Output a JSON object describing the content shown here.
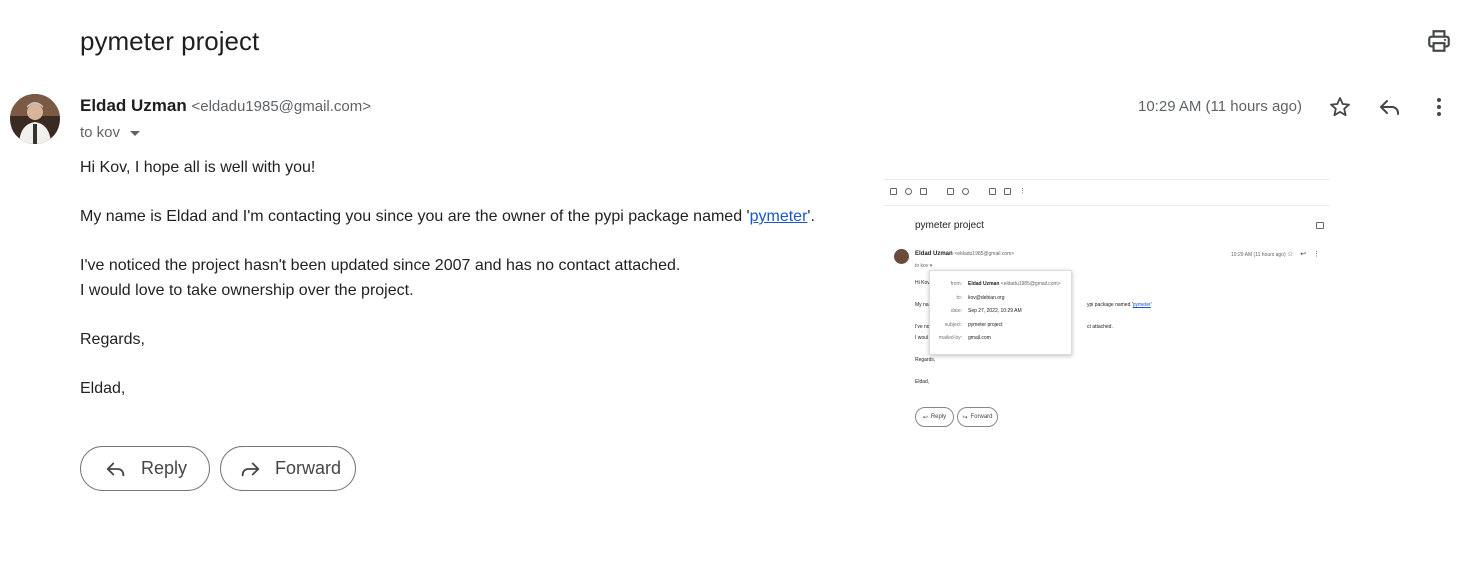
{
  "email": {
    "subject": "pymeter project",
    "sender_name": "Eldad Uzman",
    "sender_email": "<eldadu1985@gmail.com>",
    "to": "to kov",
    "timestamp": "10:29 AM (11 hours ago)",
    "body": {
      "greeting": "Hi Kov, I hope all is well with you!",
      "p2_before": "My name is Eldad and I'm contacting you since you are the owner of the pypi package named '",
      "p2_link": "pymeter",
      "p2_after": "'.",
      "p3_line1": "I've noticed the project hasn't been updated since 2007 and has no contact attached.",
      "p3_line2": "I would love to take ownership over the project.",
      "closing": "Regards,",
      "signature": "Eldad,"
    }
  },
  "actions": {
    "reply": "Reply",
    "forward": "Forward"
  },
  "icons": {
    "print": "print-icon",
    "star": "star-icon",
    "reply": "reply-icon",
    "more": "more-vert-icon",
    "forward": "forward-icon"
  },
  "embedded_screenshot": {
    "subject": "pymeter project",
    "sender_name": "Eldad Uzman",
    "sender_email": "<eldadu1985@gmail.com>",
    "to": "to kov",
    "timestamp": "10:29 AM (11 hours ago)",
    "body_lines": [
      "Hi Kov",
      "My na",
      "I've no",
      "I woul"
    ],
    "body_right_1": "ypi package named '",
    "body_link": "pymeter",
    "body_right_1_end": "'",
    "body_right_2": "ct attached.",
    "closing": "Regards,",
    "signature": "Eldad,",
    "reply": "Reply",
    "forward": "Forward",
    "details": {
      "from_label": "from:",
      "from_name": "Eldad Uzman",
      "from_email": "<eldadu1985@gmail.com>",
      "to_label": "to:",
      "to_value": "kov@debian.org",
      "date_label": "date:",
      "date_value": "Sep 27, 2022, 10:29 AM",
      "subject_label": "subject:",
      "subject_value": "pymeter project",
      "mailed_by_label": "mailed-by:",
      "mailed_by_value": "gmail.com"
    }
  }
}
